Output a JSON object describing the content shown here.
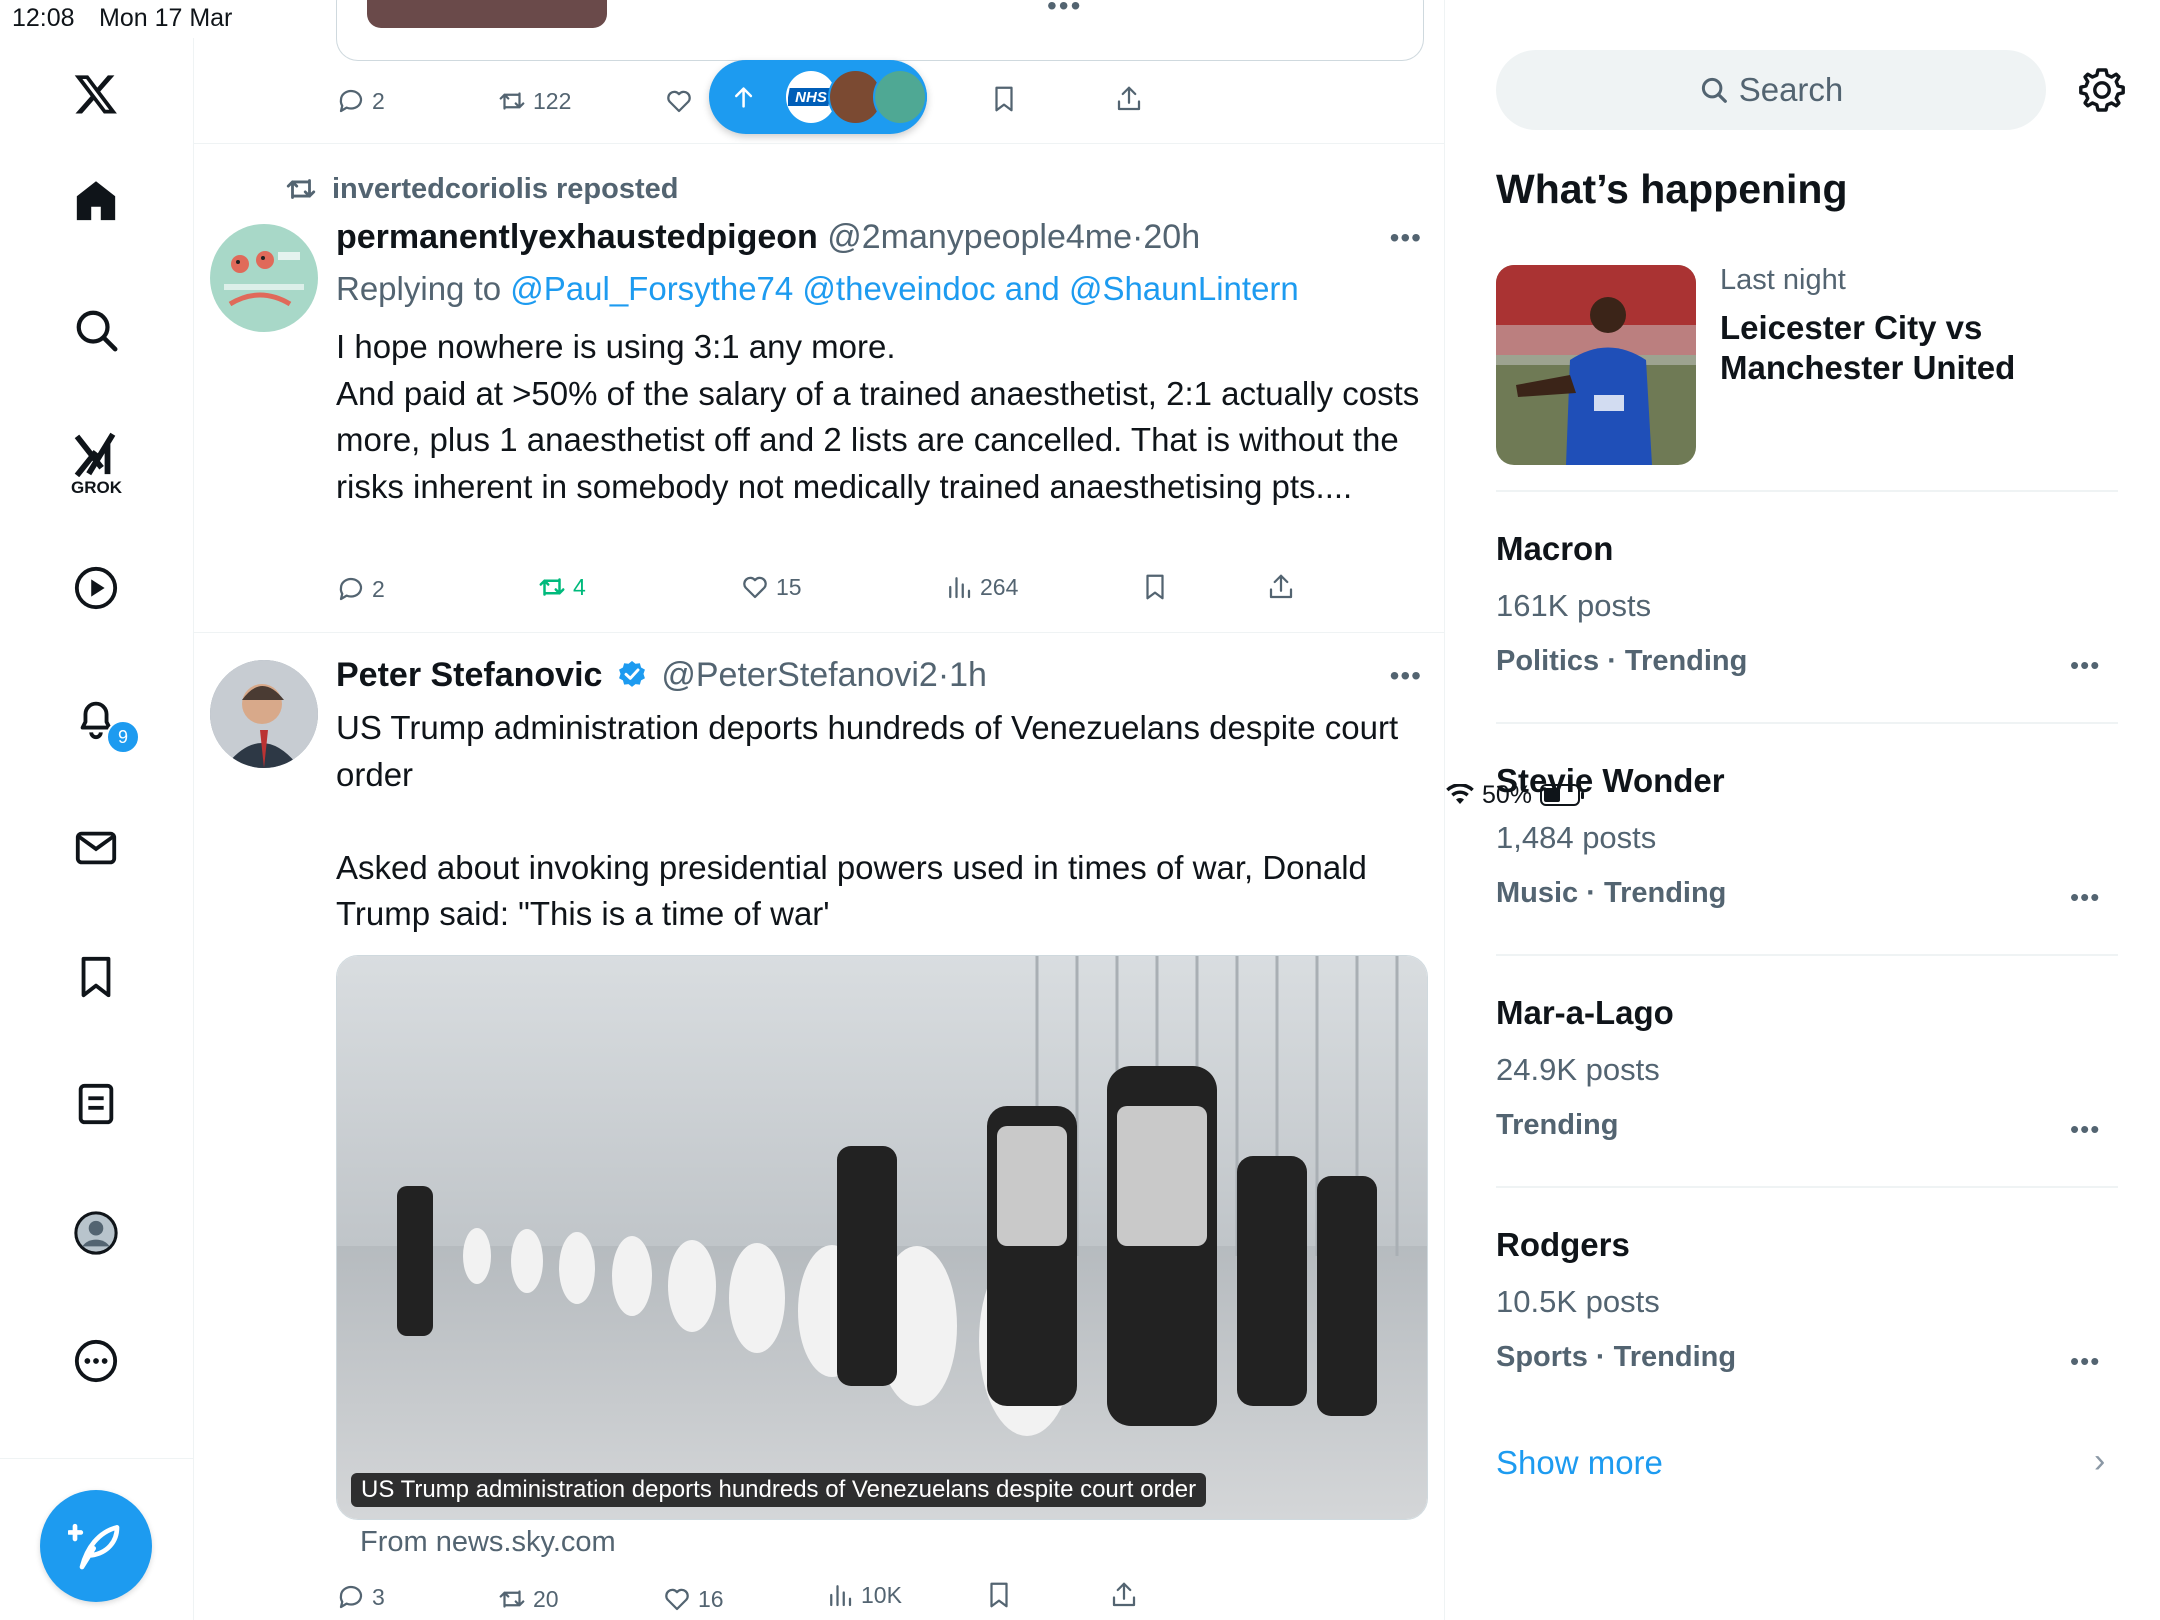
{
  "status_bar": {
    "time": "12:08",
    "date": "Mon 17 Mar",
    "battery": "50%",
    "battery_level": 0.5
  },
  "nav": {
    "grok_label": "GROK",
    "notifications_badge": "9",
    "icons": [
      "x-logo-icon",
      "home-icon",
      "search-icon",
      "grok-icon",
      "video-icon",
      "bell-icon",
      "mail-icon",
      "bookmark-icon",
      "lists-icon",
      "profile-icon",
      "more-icon",
      "compose-icon"
    ]
  },
  "prev_tweet": {
    "reply_count": "2",
    "repost_count": "122"
  },
  "tweet1": {
    "repost_label": "invertedcoriolis reposted",
    "name": "permanentlyexhaustedpigeon",
    "handle": "@2manypeople4me",
    "sep": "·",
    "time": "20h",
    "replying_prefix": "Replying to",
    "replying_users": "@Paul_Forsythe74 @theveindoc and @ShaunLintern",
    "text": "I hope nowhere is using 3:1 any more.\nAnd paid at >50% of the salary of a trained anaesthetist, 2:1 actually costs more, plus 1 anaesthetist off and 2 lists are cancelled. That is without the risks inherent in somebody not medically trained anaesthetising pts....",
    "replies": "2",
    "reposts": "4",
    "likes": "15",
    "views": "264"
  },
  "tweet2": {
    "name": "Peter Stefanovic",
    "handle": "@PeterStefanovi2",
    "sep": "·",
    "time": "1h",
    "text": "US Trump administration deports hundreds of Venezuelans despite court order\n\nAsked about invoking presidential powers used in times of war, Donald Trump said: \"This is a time of war'",
    "card_caption": "US Trump administration deports hundreds of Venezuelans despite court order",
    "card_source": "From news.sky.com",
    "replies": "3",
    "reposts": "20",
    "likes": "16",
    "views": "10K"
  },
  "sidebar": {
    "search_placeholder": "Search",
    "whats_happening": "What’s happening",
    "event": {
      "meta": "Last night",
      "title": "Leicester City vs Manchester United"
    },
    "trends": [
      {
        "name": "Macron",
        "posts": "161K posts",
        "category": "Politics · Trending"
      },
      {
        "name": "Stevie Wonder",
        "posts": "1,484 posts",
        "category": "Music · Trending"
      },
      {
        "name": "Mar-a-Lago",
        "posts": "24.9K posts",
        "category": "Trending"
      },
      {
        "name": "Rodgers",
        "posts": "10.5K posts",
        "category": "Sports · Trending"
      }
    ],
    "show_more": "Show more"
  }
}
